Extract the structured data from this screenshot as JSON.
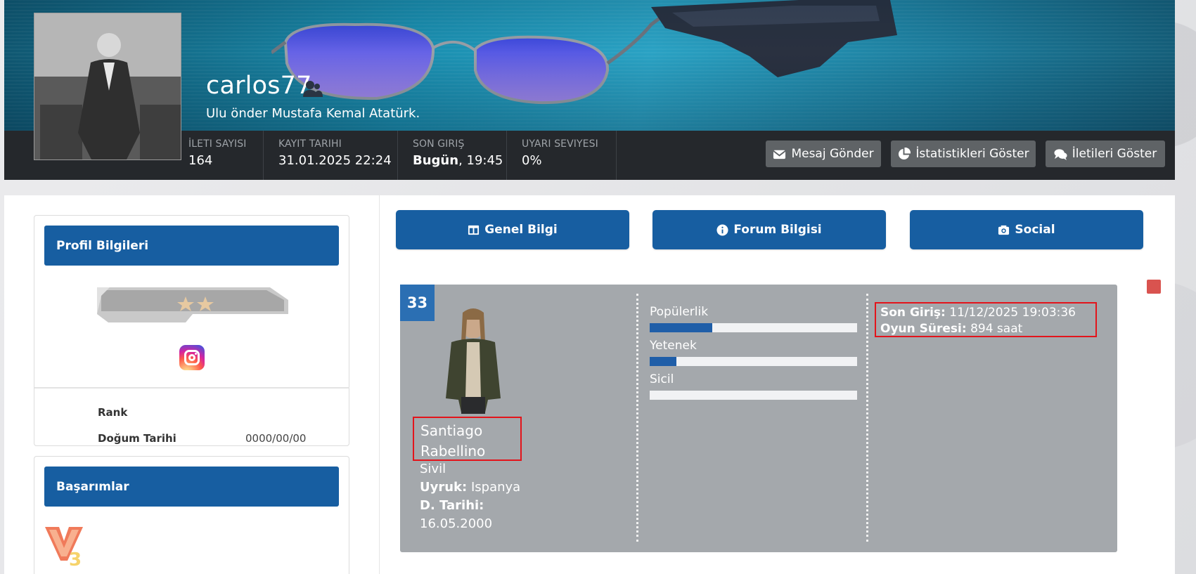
{
  "profile": {
    "username": "carlos77",
    "subtitle": "Ulu önder Mustafa Kemal Atatürk."
  },
  "stats": [
    {
      "label": "İLETI SAYISI",
      "value": "164"
    },
    {
      "label": "KAYIT TARIHI",
      "value": "31.01.2025 22:24"
    },
    {
      "label": "SON GIRIŞ",
      "value_bold": "Bugün",
      "value_rest": ", 19:45"
    },
    {
      "label": "UYARI SEVIYESI",
      "value": "0%"
    }
  ],
  "header_buttons": {
    "message": "Mesaj Gönder",
    "statistics": "İstatistikleri Göster",
    "posts": "İletileri Göster"
  },
  "sidebar": {
    "profile_info_title": "Profil Bilgileri",
    "rank_label": "Rank",
    "birth_label": "Doğum Tarihi",
    "birth_value": "0000/00/00",
    "achievements_title": "Başarımlar"
  },
  "tabs": {
    "general": "Genel Bilgi",
    "forum": "Forum Bilgisi",
    "social": "Social"
  },
  "character": {
    "level": "33",
    "first_name": "Santiago",
    "last_name": "Rabellino",
    "job": "Sivil",
    "nationality_label": "Uyruk:",
    "nationality_value": "Ispanya",
    "birth_label": "D. Tarihi:",
    "birth_value": "16.05.2000",
    "bars": [
      {
        "label": "Popülerlik",
        "fill": 0.3
      },
      {
        "label": "Yetenek",
        "fill": 0.13
      },
      {
        "label": "Sicil",
        "fill": 0.0
      }
    ],
    "last_login_label": "Son Giriş:",
    "last_login_value": "11/12/2025 19:03:36",
    "play_time_label": "Oyun Süresi:",
    "play_time_value": "894 saat"
  },
  "colors": {
    "primary": "#175ea1",
    "stats_bar": "#25282c",
    "card_bg": "#a4a8ac",
    "highlight_border": "#e3141b"
  }
}
